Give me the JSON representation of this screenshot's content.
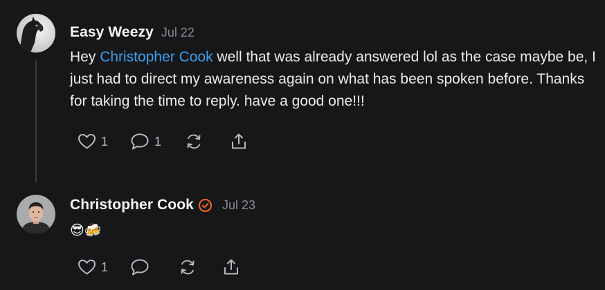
{
  "comments": [
    {
      "author": "Easy Weezy",
      "date": "Jul 22",
      "body": {
        "prefix": "Hey ",
        "mention": "Christopher Cook",
        "suffix": " well that was already answered lol as the case maybe be, I just had to direct my awareness again on what has been spoken before. Thanks for taking the time to reply. have a good one!!!"
      },
      "actions": {
        "like_count": "1",
        "reply_count": "1"
      },
      "avatar_icon": "horse-avatar"
    },
    {
      "author": "Christopher Cook",
      "verified_icon": "verified-badge-icon",
      "date": "Jul 23",
      "body_emoji": "😎🍻",
      "actions": {
        "like_count": "1"
      },
      "avatar_icon": "person-avatar"
    }
  ],
  "colors": {
    "background": "#17171a",
    "mention": "#3b9ff0",
    "verified": "#ff6719",
    "muted": "#8a8a8f"
  }
}
